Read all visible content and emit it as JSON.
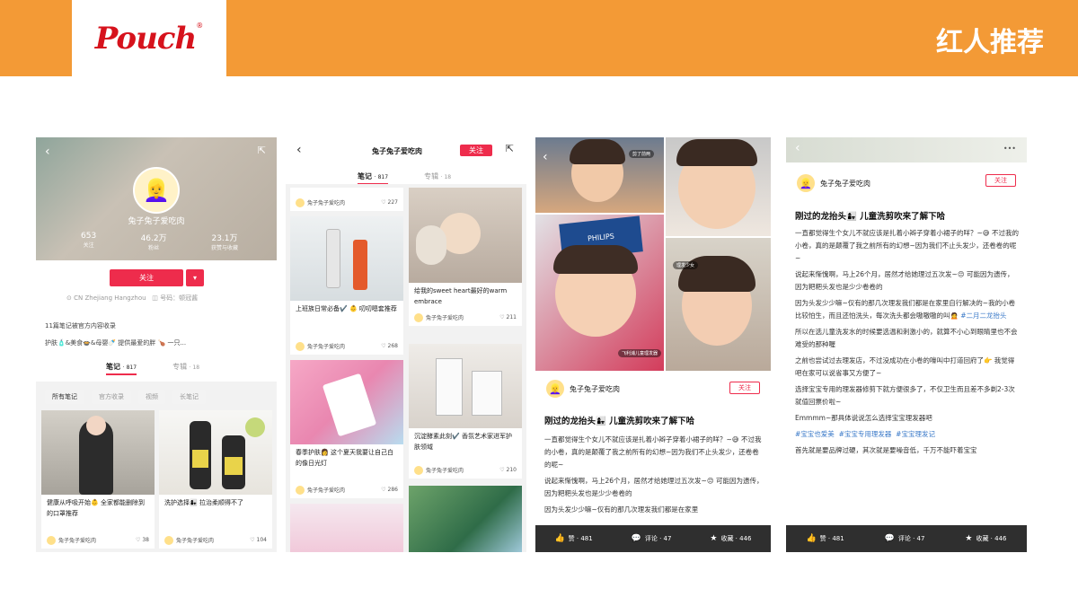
{
  "header": {
    "logo_text": "Pouch",
    "logo_reg": "®",
    "title": "红人推荐",
    "accent_color": "#f39a36",
    "brand_color": "#d6121c"
  },
  "icons": {
    "back": "‹",
    "share": "⇱",
    "heart": "♡",
    "like": "👍",
    "comment": "💬",
    "star": "★",
    "more": "•••",
    "location": "⊙",
    "id": "◫",
    "avatar": "👱‍♀️"
  },
  "profile": {
    "name": "兔子兔子爱吃肉",
    "stats": [
      {
        "num": "653",
        "label": "关注"
      },
      {
        "num": "46.2万",
        "label": "粉丝"
      },
      {
        "num": "23.1万",
        "label": "获赞与收藏"
      }
    ],
    "follow_label": "关注",
    "more_label": "▾",
    "location": "CN Zhejiang Hangzhou",
    "id_text": "号码：顿冠酱",
    "notes_note": "11篇笔记被官方内容收录",
    "intro": "护肤🧴&美食🍲&母婴🍼 提供最爱的胖 🍗 一只...",
    "tabs": [
      {
        "label": "笔记",
        "count": "· 817"
      },
      {
        "label": "专辑",
        "count": "· 18"
      }
    ],
    "filters": [
      "所有笔记",
      "官方收录",
      "视频",
      "长笔记"
    ],
    "cards": [
      {
        "title": "健康从呼吸开始👶 全家都能删除到的口罩推荐",
        "author": "兔子兔子爱吃肉",
        "likes": "38"
      },
      {
        "title": "洗护选择👩‍👧 拉治柔顺得不了",
        "author": "兔子兔子爱吃肉",
        "likes": "104"
      }
    ]
  },
  "feed": {
    "title": "兔子兔子爱吃肉",
    "follow_label": "关注",
    "tabs": [
      {
        "label": "笔记",
        "count": "· 817"
      },
      {
        "label": "专辑",
        "count": "· 18"
      }
    ],
    "left": [
      {
        "title": "",
        "author": "兔子兔子爱吃肉",
        "likes": "227"
      },
      {
        "title": "上班族日常必备✔️ 👶 叨叨嗯套推荐",
        "author": "兔子兔子爱吃肉",
        "likes": "268"
      },
      {
        "title": "春季护肤👩 这个夏天我要让自己白的像日光灯",
        "author": "兔子兔子爱吃肉",
        "likes": "286"
      }
    ],
    "right": [
      {
        "title": "给我的sweet heart最好的warm embrace",
        "author": "兔子兔子爱吃肉",
        "likes": "211"
      },
      {
        "title": "沉淀酵素此刻✔️ 香氛艺术家进军护肤领域",
        "author": "兔子兔子爱吃肉",
        "likes": "210"
      }
    ]
  },
  "post": {
    "author": "兔子兔子爱吃肉",
    "follow_label": "关注",
    "title": "刚过的龙抬头👩‍👧 儿童洗剪吹来了解下哈",
    "tags": [
      "剪了前两",
      "理发少女",
      "飞利浦儿童理发器"
    ],
    "brand_box": "PHILIPS",
    "paragraphs": [
      "一直都觉得生个女儿不就应该是扎着小辫子穿着小裙子的咩？~😅 不过我的小卷，真的是颠覆了我之前所有的幻想~因为我们不止头发少，还卷卷的呢~",
      "说起来惭愧啊，马上26个月，居然才给她理过五次发~😔 可能因为遗传，因为粑粑头发也是少少卷卷的",
      "因为头发少少嘛~仅有的那几次理发我们都是在家里"
    ],
    "bar": [
      {
        "icon": "👍",
        "label": "赞 · 481"
      },
      {
        "icon": "💬",
        "label": "评论 · 47"
      },
      {
        "icon": "★",
        "label": "收藏 · 446"
      }
    ]
  },
  "post2": {
    "author": "兔子兔子爱吃肉",
    "follow_label": "关注",
    "title": "刚过的龙抬头👩‍👧 儿童洗剪吹来了解下哈",
    "paragraphs": [
      "一直都觉得生个女儿不就应该是扎着小辫子穿着小裙子的咩？~😅 不过我的小卷，真的是颠覆了我之前所有的幻想~因为我们不止头发少，还卷卷的呢~",
      "说起来惭愧啊，马上26个月，居然才给她理过五次发~😔 可能因为遗传，因为粑粑头发也是少少卷卷的",
      "因为头发少少嘛~仅有的那几次理发我们都是在家里自行解决的~我的小卷比较怕生，而且还怕洗头，每次洗头都会嗷嗷嗷的叫🙍",
      "所以在选儿童洗发水的时候要选温和刺激小的，就算不小心到眼睛里也不会难受的那种喔",
      "之前也尝试过去理发店，不过没成功在小卷的嚎叫中打道回府了👉 我觉得吧在家可以说省事又方便了~",
      "选择宝宝专用的理发器修剪下就方便很多了，不仅卫生而且差不多剃2-3次就值回票价啦~",
      "Emmmm~那具体说说怎么选择宝宝理发器吧",
      "首先就是要品牌过硬，其次就是要噪音低，千万不能吓着宝宝"
    ],
    "hashtag1": "#二月二龙抬头",
    "hashtags": [
      "#宝宝也爱美",
      "#宝宝专用理发器",
      "#宝宝理发记"
    ],
    "bar": [
      {
        "icon": "👍",
        "label": "赞 · 481"
      },
      {
        "icon": "💬",
        "label": "评论 · 47"
      },
      {
        "icon": "★",
        "label": "收藏 · 446"
      }
    ]
  }
}
